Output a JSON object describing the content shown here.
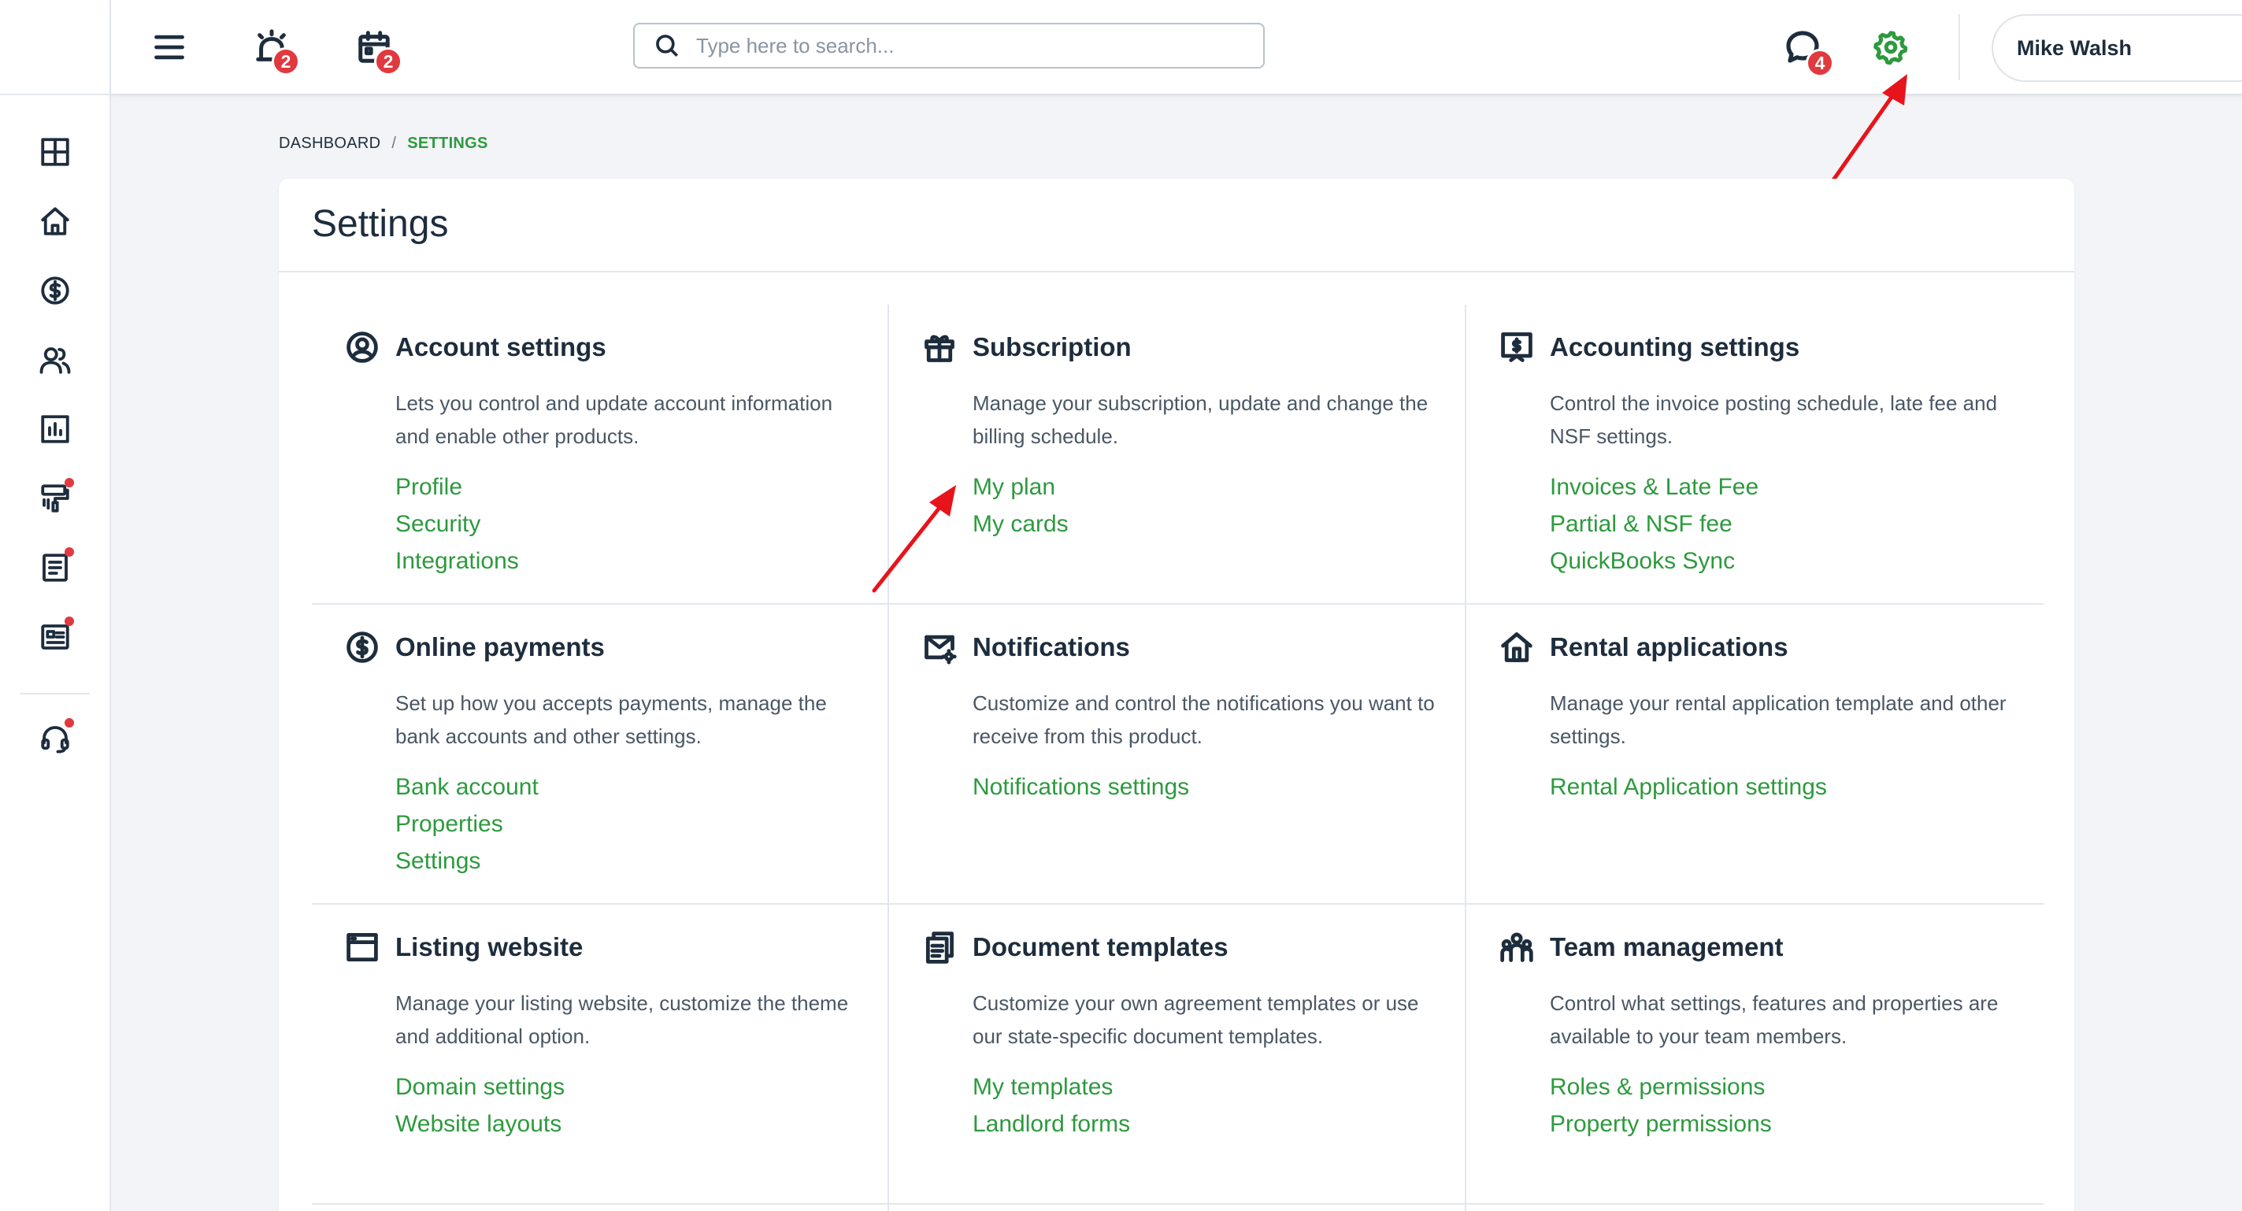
{
  "header": {
    "alerts_badge": "2",
    "calendar_badge": "2",
    "messages_badge": "4",
    "search_placeholder": "Type here to search...",
    "user_name": "Mike Walsh"
  },
  "breadcrumb": {
    "root": "DASHBOARD",
    "separator": "/",
    "current": "SETTINGS"
  },
  "page": {
    "title": "Settings"
  },
  "sections": [
    {
      "icon": "user-circle-icon",
      "title": "Account settings",
      "description": "Lets you control and update account information and enable other products.",
      "links": [
        "Profile",
        "Security",
        "Integrations"
      ]
    },
    {
      "icon": "gift-icon",
      "title": "Subscription",
      "description": "Manage your subscription, update and change the billing schedule.",
      "links": [
        "My plan",
        "My cards"
      ]
    },
    {
      "icon": "accounting-icon",
      "title": "Accounting settings",
      "description": "Control the invoice posting schedule, late fee and NSF settings.",
      "links": [
        "Invoices & Late Fee",
        "Partial & NSF fee",
        "QuickBooks Sync"
      ]
    },
    {
      "icon": "dollar-circle-icon",
      "title": "Online payments",
      "description": "Set up how you accepts payments, manage the bank accounts and other settings.",
      "links": [
        "Bank account",
        "Properties",
        "Settings"
      ]
    },
    {
      "icon": "mail-gear-icon",
      "title": "Notifications",
      "description": "Customize and control the notifications you want to receive from this product.",
      "links": [
        "Notifications settings"
      ]
    },
    {
      "icon": "house-icon",
      "title": "Rental applications",
      "description": "Manage your rental application template and other settings.",
      "links": [
        "Rental Application settings"
      ]
    },
    {
      "icon": "browser-window-icon",
      "title": "Listing website",
      "description": "Manage your listing website, customize the theme and additional option.",
      "links": [
        "Domain settings",
        "Website layouts"
      ]
    },
    {
      "icon": "documents-icon",
      "title": "Document templates",
      "description": "Customize your own agreement templates or use our state-specific document templates.",
      "links": [
        "My templates",
        "Landlord forms"
      ]
    },
    {
      "icon": "team-icon",
      "title": "Team management",
      "description": "Control what settings, features and properties are available to your team members.",
      "links": [
        "Roles & permissions",
        "Property permissions"
      ]
    }
  ],
  "colors": {
    "accent_green": "#2d9a3e",
    "badge_red": "#e0393e",
    "text_dark": "#1e2d3d",
    "annotation_arrow": "#e8141b"
  }
}
